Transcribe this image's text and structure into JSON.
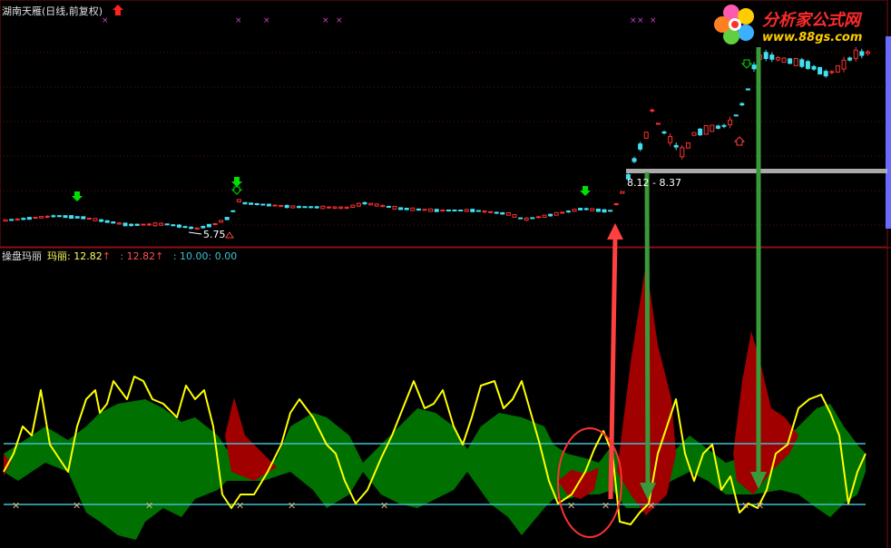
{
  "window": {
    "title": "湖南天雁(日线,前复权)"
  },
  "indicator": {
    "name": "操盘玛丽",
    "series_label": "玛丽",
    "value1": ": 12.82",
    "value2": ": 12.82",
    "value3": ": 10.00",
    "value4": ": 0.00",
    "arrow": "↑"
  },
  "annotations": {
    "price_low": "5.75",
    "price_range": "8.12 - 8.37"
  },
  "logo": {
    "name": "分析家公式网",
    "url": "www.88gs.com"
  },
  "colors": {
    "background": "#000000",
    "up_candle": "#ff3030",
    "down_candle": "#40e0f0",
    "yellow_line": "#ffff00",
    "cyan_line": "#40c0d0",
    "green_fill": "#007000",
    "red_fill": "#a00000",
    "signal_arrow_green": "#00ff00",
    "signal_arrow_red": "#ff2020",
    "annotation_red": "#ff4040",
    "annotation_green": "#3a9a3a"
  },
  "icons": {
    "title_signal": "red-up-arrow-icon",
    "cross_marks": "magenta-x-icon",
    "logo_flower": "flower-logo-icon"
  }
}
